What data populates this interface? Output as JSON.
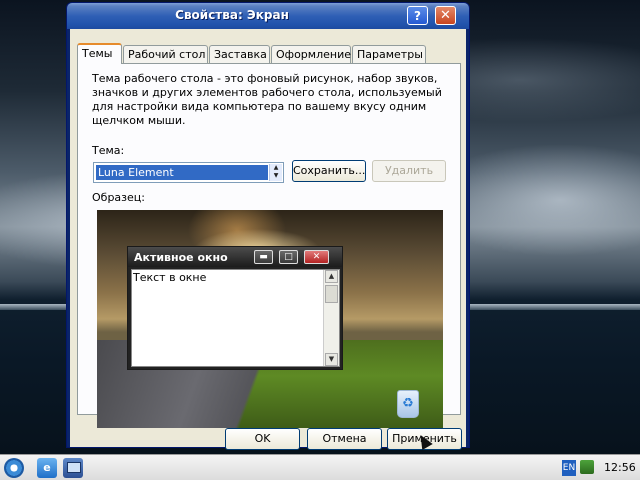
{
  "window": {
    "title": "Свойства: Экран",
    "help_glyph": "?",
    "close_glyph": "✕"
  },
  "tabs": [
    "Темы",
    "Рабочий стол",
    "Заставка",
    "Оформление",
    "Параметры"
  ],
  "themes_tab": {
    "description": "Тема рабочего стола - это фоновый рисунок, набор звуков, значков и других элементов рабочего стола, используемый для настройки вида компьютера по вашему вкусу одним щелчком мыши.",
    "theme_label": "Тема:",
    "theme_value": "Luna Element",
    "save_button": "Сохранить...",
    "delete_button": "Удалить",
    "preview_label": "Образец:"
  },
  "preview_window": {
    "title": "Активное окно",
    "body_text": "Текст в окне",
    "minimize_glyph": "▬",
    "maximize_glyph": "□",
    "close_glyph": "✕"
  },
  "dialog_buttons": {
    "ok": "OK",
    "cancel": "Отмена",
    "apply": "Применить"
  },
  "taskbar": {
    "ie_glyph": "e",
    "language": "EN",
    "clock": "12:56"
  },
  "icons": [
    "start-orb-icon",
    "internet-explorer-icon",
    "show-desktop-icon",
    "network-icon",
    "recycle-bin-icon"
  ]
}
